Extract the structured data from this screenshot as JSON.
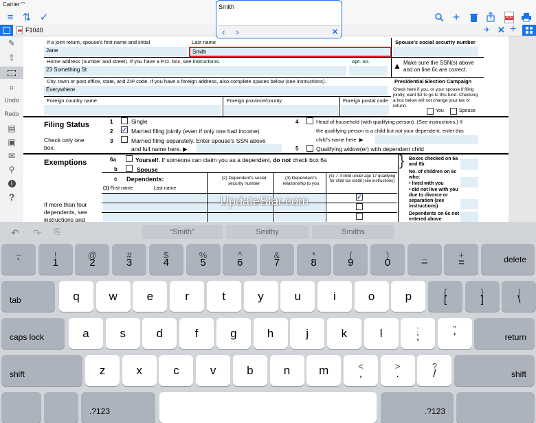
{
  "status_bar": {
    "carrier": "Carrier"
  },
  "toolbar": {
    "left_icons": [
      "list-icon",
      "sort-icon",
      "checkmark-icon"
    ],
    "right_icons": [
      "search-icon",
      "add-icon",
      "trash-icon",
      "share-icon",
      "pdf-icon",
      "print-icon"
    ],
    "pdf_badge": "PDF"
  },
  "search": {
    "query": "Smith"
  },
  "tab": {
    "name": "F1040"
  },
  "tools": {
    "undo": "Undo",
    "redo": "Redo"
  },
  "form": {
    "spouse_first_label": "If a joint return, spouse's first name and initial",
    "spouse_first_value": "Jane",
    "last_name_label": "Last name",
    "last_name_value": "Smith",
    "spouse_ssn_label": "Spouse's social security number",
    "home_address_label": "Home address (number and street). If you have a P.O. box, see instructions.",
    "home_address_value": "23 Something St",
    "apt_label": "Apt. no.",
    "ssn_note": "Make sure the SSN(s) above and on line 6c are correct.",
    "city_label": "City, town or post office, state, and ZIP code. If you have a foreign address, also complete spaces below (see instructions).",
    "city_value": "Everywhere",
    "pec_title": "Presidential Election Campaign",
    "pec_text": "Check here if you, or your spouse if filing jointly, want $3 to go to this fund. Checking a box below will not change your tax or refund.",
    "pec_you": "You",
    "pec_spouse": "Spouse",
    "foreign_country_label": "Foreign country name",
    "foreign_province_label": "Foreign province/county",
    "foreign_postal_label": "Foreign postal code",
    "filing_status_title": "Filing Status",
    "filing_status_note1": "Check only one",
    "filing_status_note2": "box.",
    "fs1_num": "1",
    "fs1_text": "Single",
    "fs2_num": "2",
    "fs2_text": "Married filing jointly (even if only one had income)",
    "fs3_num": "3",
    "fs3_text": "Married filing separately. Enter spouse's SSN above",
    "fs3_text2": "and full name here. ▶",
    "fs4_num": "4",
    "fs4_text": "Head of household (with qualifying person). (See instructions.) If",
    "fs4_text2": "the qualifying person is a child but not your dependent, enter this",
    "fs4_text3": "child's name here. ▶",
    "fs5_num": "5",
    "fs5_text": "Qualifying widow(er) with dependent child",
    "exemptions_title": "Exemptions",
    "e6a_num": "6a",
    "e6a_bold": "Yourself.",
    "e6a_text": "If someone can claim you as a dependent,",
    "e6a_do_not": "do not",
    "e6a_tail": "check box 6a",
    "e6b_num": "b",
    "e6b_text": "Spouse",
    "e6c_num": "c",
    "e6c_text": "Dependents:",
    "dep_col1_num": "(1)",
    "dep_col1_first": "First name",
    "dep_col1_last": "Last name",
    "dep_col2": "(2) Dependent's social security number",
    "dep_col3": "(3) Dependent's relationship to you",
    "dep_col4": "(4) ✓ if child under age 17 qualifying for child tax credit (see instructions)",
    "boxes_checked": "Boxes checked on 6a and 6b",
    "no_children": "No. of children on 6c who:",
    "lived_with": "• lived with you",
    "did_not_live": "• did not live with you due to divorce or separation (see instructions)",
    "dependents_not_entered": "Dependents on 6c not entered above",
    "more_than_four_1": "If more than four",
    "more_than_four_2": "dependents, see",
    "more_than_four_3": "instructions and",
    "watermark": "UpdateStar.com"
  },
  "keyboard": {
    "suggestions": [
      "“Smith”",
      "Smithy",
      "Smiths"
    ],
    "row1": [
      [
        "~",
        "`"
      ],
      [
        "!",
        "1"
      ],
      [
        "@",
        "2"
      ],
      [
        "#",
        "3"
      ],
      [
        "$",
        "4"
      ],
      [
        "%",
        "5"
      ],
      [
        "^",
        "6"
      ],
      [
        "&",
        "7"
      ],
      [
        "*",
        "8"
      ],
      [
        "(",
        "9"
      ],
      [
        ")",
        "0"
      ],
      [
        "_",
        "–"
      ],
      [
        "+",
        "="
      ]
    ],
    "delete": "delete",
    "tab": "tab",
    "row2": [
      "q",
      "w",
      "e",
      "r",
      "t",
      "y",
      "u",
      "i",
      "o",
      "p"
    ],
    "row2_extra": [
      [
        "{",
        "["
      ],
      [
        "}",
        "]"
      ],
      [
        "|",
        "\\"
      ]
    ],
    "caps": "caps lock",
    "row3": [
      "a",
      "s",
      "d",
      "f",
      "g",
      "h",
      "j",
      "k",
      "l"
    ],
    "row3_extra": [
      [
        ":",
        ";"
      ],
      [
        "”",
        "’"
      ]
    ],
    "return": "return",
    "shift": "shift",
    "row4": [
      "z",
      "x",
      "c",
      "v",
      "b",
      "n",
      "m"
    ],
    "row4_extra": [
      [
        "<",
        ","
      ],
      [
        ">",
        "."
      ],
      [
        "?",
        "/"
      ]
    ],
    "numkey": ".?123"
  }
}
